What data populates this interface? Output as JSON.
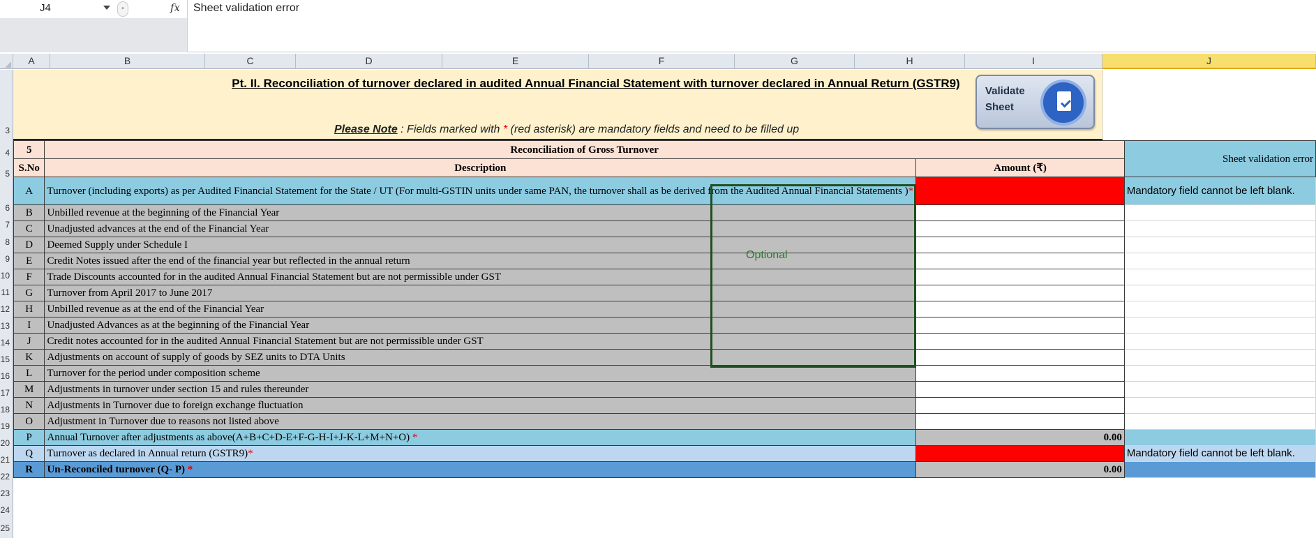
{
  "formula_bar": {
    "cell_ref": "J4",
    "fx_label": "fx",
    "formula": "Sheet validation error"
  },
  "columns": [
    "A",
    "B",
    "C",
    "D",
    "E",
    "F",
    "G",
    "H",
    "I",
    "J"
  ],
  "selected_column": "J",
  "row_numbers": [
    "3",
    "4",
    "5",
    "6",
    "7",
    "8",
    "9",
    "10",
    "11",
    "12",
    "13",
    "14",
    "15",
    "16",
    "17",
    "18",
    "19",
    "20",
    "21",
    "22",
    "23",
    "24",
    "25"
  ],
  "banner": {
    "title": "Pt. II. Reconciliation of turnover declared in audited Annual Financial Statement with turnover declared in Annual Return (GSTR9)",
    "note_label": "Please Note",
    "note_pre": " : Fields marked with ",
    "note_asterisk": "*",
    "note_post": " (red asterisk) are mandatory fields and need to be filled up"
  },
  "validate_button": {
    "label": "Validate\nSheet"
  },
  "table": {
    "section_no": "5",
    "section_title": "Reconciliation of Gross Turnover",
    "col_sno": "S.No",
    "col_desc": "Description",
    "col_amount": "Amount (₹)",
    "error_header": "Sheet validation error",
    "rows": [
      {
        "sno": "A",
        "desc": "Turnover (including exports) as per Audited Financial Statement  for the State / UT (For multi-GSTIN units under same PAN, the turnover shall as be derived from the Audited Annual Financial Statements )",
        "mandatory": "*",
        "amount": "",
        "error": "Mandatory field cannot be left blank."
      },
      {
        "sno": "B",
        "desc": "Unbilled revenue at the beginning of the Financial Year",
        "mandatory": "",
        "amount": "",
        "error": ""
      },
      {
        "sno": "C",
        "desc": "Unadjusted advances at the end of the Financial Year",
        "mandatory": "",
        "amount": "",
        "error": ""
      },
      {
        "sno": "D",
        "desc": "Deemed Supply under Schedule I",
        "mandatory": "",
        "amount": "",
        "error": ""
      },
      {
        "sno": "E",
        "desc": "Credit Notes issued after the end of the financial year but reflected in the annual return",
        "mandatory": "",
        "amount": "",
        "error": ""
      },
      {
        "sno": "F",
        "desc": "Trade Discounts  accounted for in the audited Annual Financial Statement but are not permissible under GST",
        "mandatory": "",
        "amount": "",
        "error": ""
      },
      {
        "sno": "G",
        "desc": "Turnover from April 2017 to June 2017",
        "mandatory": "",
        "amount": "",
        "error": ""
      },
      {
        "sno": "H",
        "desc": "Unbilled revenue as at the end of the Financial Year",
        "mandatory": "",
        "amount": "",
        "error": ""
      },
      {
        "sno": "I",
        "desc": "Unadjusted Advances as at the beginning of the Financial Year",
        "mandatory": "",
        "amount": "",
        "error": ""
      },
      {
        "sno": "J",
        "desc": "Credit notes accounted for in the audited Annual Financial Statement but are not permissible under GST",
        "mandatory": "",
        "amount": "",
        "error": ""
      },
      {
        "sno": "K",
        "desc": "Adjustments on account of supply of goods by SEZ units to DTA Units",
        "mandatory": "",
        "amount": "",
        "error": ""
      },
      {
        "sno": "L",
        "desc": "Turnover for the period under composition scheme",
        "mandatory": "",
        "amount": "",
        "error": ""
      },
      {
        "sno": "M",
        "desc": "Adjustments in turnover under section 15 and rules thereunder",
        "mandatory": "",
        "amount": "",
        "error": ""
      },
      {
        "sno": "N",
        "desc": "Adjustments in Turnover due to foreign exchange fluctuation",
        "mandatory": "",
        "amount": "",
        "error": ""
      },
      {
        "sno": "O",
        "desc": "Adjustment in Turnover due to reasons not listed above",
        "mandatory": "",
        "amount": "",
        "error": ""
      },
      {
        "sno": "P",
        "desc": "Annual Turnover after adjustments as above(A+B+C+D-E+F-G-H-I+J-K-L+M+N+O) ",
        "mandatory": "*",
        "amount": "0.00",
        "error": ""
      },
      {
        "sno": "Q",
        "desc": "Turnover as declared in Annual return (GSTR9)",
        "mandatory": "*",
        "amount": "",
        "error": "Mandatory field cannot be left blank."
      },
      {
        "sno": "R",
        "desc": "Un-Reconciled turnover  (Q- P) ",
        "mandatory": "*",
        "amount": "0.00",
        "error": ""
      }
    ],
    "optional_label": "Optional"
  },
  "colors": {
    "banner_bg": "#fef1cc",
    "header_pink": "#fbe2d4",
    "row_blue": "#8ccbe0",
    "row_gray": "#bfbfbf",
    "row_light_blue": "#bcd7ef",
    "row_mid_blue": "#5b9bd5",
    "error_red": "#ff0000",
    "asterisk_red": "#e00000",
    "optional_border": "#1f4e1f",
    "selected_col": "#f7df6e"
  }
}
